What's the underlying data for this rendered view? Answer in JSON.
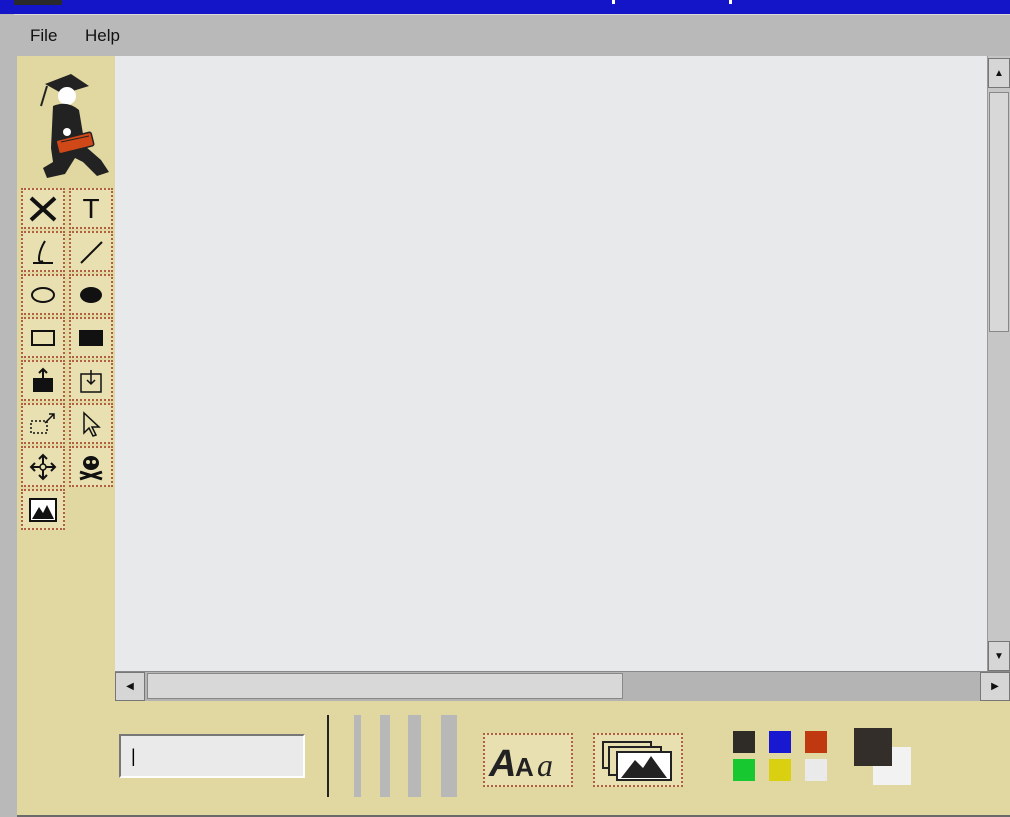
{
  "menubar": {
    "items": [
      {
        "label": "File"
      },
      {
        "label": "Help"
      }
    ]
  },
  "toolbar": {
    "tools": [
      {
        "name": "clear-tool",
        "icon": "x-icon"
      },
      {
        "name": "text-tool",
        "icon": "text-t-icon",
        "glyph": "T"
      },
      {
        "name": "freehand-tool",
        "icon": "pen-icon"
      },
      {
        "name": "line-tool",
        "icon": "line-icon"
      },
      {
        "name": "oval-tool",
        "icon": "oval-outline-icon"
      },
      {
        "name": "filled-oval-tool",
        "icon": "oval-filled-icon"
      },
      {
        "name": "rectangle-tool",
        "icon": "rect-outline-icon"
      },
      {
        "name": "filled-rectangle-tool",
        "icon": "rect-filled-icon"
      },
      {
        "name": "export-tool",
        "icon": "upload-icon"
      },
      {
        "name": "import-tool",
        "icon": "download-icon"
      },
      {
        "name": "resize-tool",
        "icon": "resize-icon"
      },
      {
        "name": "select-tool",
        "icon": "pointer-arrow-icon"
      },
      {
        "name": "move-tool",
        "icon": "move-icon"
      },
      {
        "name": "delete-tool",
        "icon": "skull-crossbones-icon"
      },
      {
        "name": "image-tool",
        "icon": "mountain-image-icon"
      }
    ]
  },
  "bottombar": {
    "text_input": {
      "value": "|"
    },
    "font_button": {
      "icon": "font-style-icon",
      "glyphs": "AAa"
    },
    "image_stack_button": {
      "icon": "image-stack-icon"
    },
    "palette": [
      "#2f2c28",
      "#1818d0",
      "#c03810",
      "#18c830",
      "#d8d010",
      "#eaeaea"
    ],
    "foreground_color": "#332e2a",
    "background_color": "#f2f2f2"
  },
  "colors": {
    "title_bar": "#1414c8",
    "panel_bg": "#e0d8a0",
    "canvas_bg": "#e8e9ea",
    "tool_border": "#b06040"
  }
}
